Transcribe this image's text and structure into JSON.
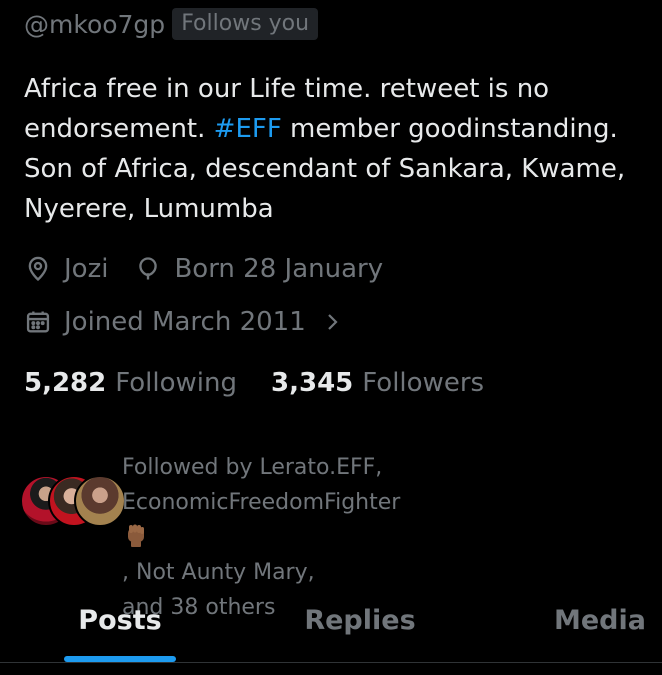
{
  "profile": {
    "handle": "@mkoo7gp",
    "follows_badge": "Follows you",
    "bio": {
      "line1": "Africa free in our Life time. retweet is no",
      "line2_pre": "endorsement. ",
      "line2_hashtag": "#EFF",
      "line2_post": " member goodinstanding.",
      "line3": "Son of Africa, descendant of Sankara, Kwame,",
      "line4": "Nyerere, Lumumba"
    },
    "location": "Jozi",
    "birthday": "Born 28 January",
    "joined": "Joined March 2011",
    "following_count": "5,282",
    "following_label": "Following",
    "followers_count": "3,345",
    "followers_label": "Followers"
  },
  "followed_by": {
    "line1": "Followed by Lerato.EFF,",
    "line2_pre": "EconomicFreedomFighter",
    "line2_post": ", Not Aunty Mary,",
    "line3": "and 38 others"
  },
  "tabs": [
    {
      "label": "Posts",
      "active": true
    },
    {
      "label": "Replies",
      "active": false
    },
    {
      "label": "Media",
      "active": false
    }
  ],
  "icons": {
    "location": "location-pin-icon",
    "birthday": "balloon-icon",
    "joined": "calendar-icon",
    "chevron": "chevron-right-icon",
    "fist_emoji": "raised-fist-emoji"
  },
  "colors": {
    "background": "#000000",
    "primary_text": "#e7e9ea",
    "secondary_text": "#71767b",
    "accent": "#1d9bf0",
    "badge_bg": "#202327"
  }
}
